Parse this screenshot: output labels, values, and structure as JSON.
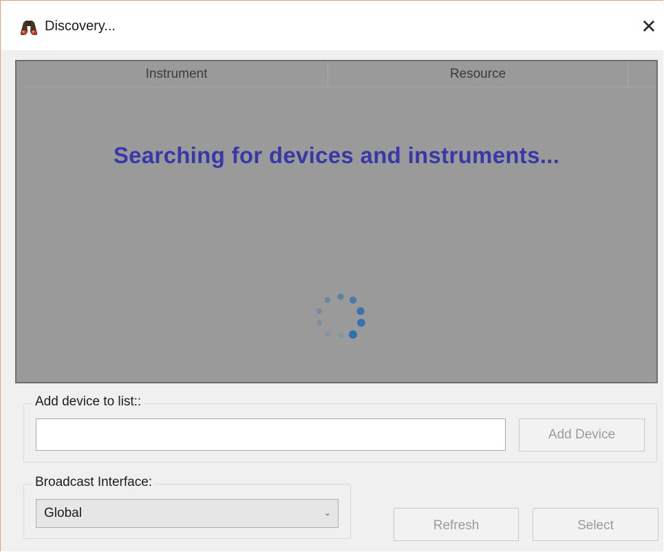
{
  "window": {
    "title": "Discovery...",
    "close_glyph": "✕",
    "app_icon": "binoculars-icon"
  },
  "grid": {
    "columns": [
      "Instrument",
      "Resource"
    ],
    "rows": [],
    "status_message": "Searching for devices and instruments...",
    "loading_indicator": "spinner-icon"
  },
  "add_device": {
    "group_label": "Add device to list::",
    "input_value": "",
    "button_label": "Add Device",
    "button_enabled": false
  },
  "broadcast": {
    "group_label": "Broadcast Interface:",
    "selected": "Global"
  },
  "actions": {
    "refresh_label": "Refresh",
    "select_label": "Select"
  },
  "colors": {
    "status_text": "#3a38a8",
    "overlay": "#9a9a9a",
    "spinner": "#2f6fb0",
    "window_border": "#e3a06a"
  }
}
